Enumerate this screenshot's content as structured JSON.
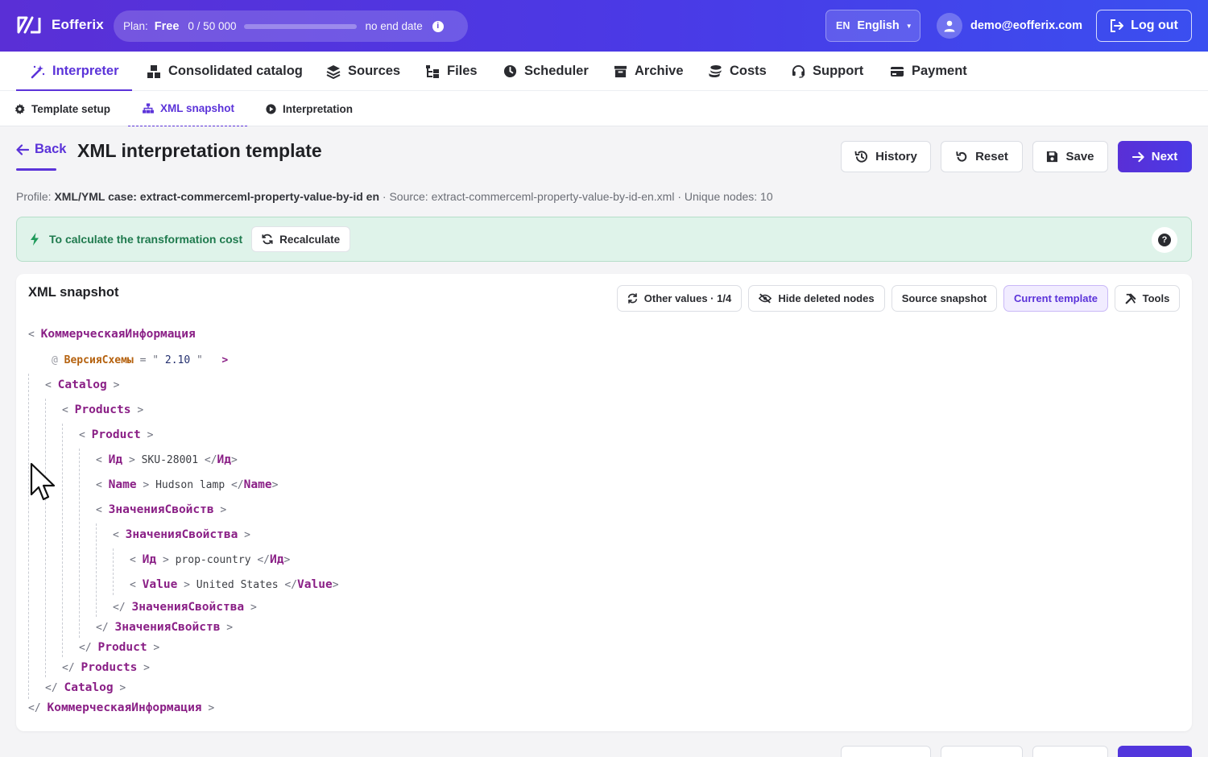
{
  "app": {
    "name": "Eofferix"
  },
  "plan": {
    "label": "Plan:",
    "name": "Free",
    "usage": "0 / 50 000",
    "usage_fraction": 0,
    "expiry": "no end date"
  },
  "language": {
    "code": "EN",
    "name": "English"
  },
  "user": {
    "email": "demo@eofferix.com"
  },
  "logout_label": "Log out",
  "main_nav": [
    "Interpreter",
    "Consolidated catalog",
    "Sources",
    "Files",
    "Scheduler",
    "Archive",
    "Costs",
    "Support",
    "Payment"
  ],
  "sub_nav": [
    "Template setup",
    "XML snapshot",
    "Interpretation"
  ],
  "page": {
    "back_label": "Back",
    "title": "XML interpretation template",
    "buttons": {
      "history": "History",
      "reset": "Reset",
      "save": "Save",
      "next": "Next"
    },
    "profile_label": "Profile:",
    "profile_value": "XML/YML case: extract-commerceml-property-value-by-id en",
    "source_text": "· Source: extract-commerceml-property-value-by-id-en.xml · Unique nodes: 10"
  },
  "cost_banner": {
    "text": "To calculate the transformation cost",
    "button": "Recalculate"
  },
  "snapshot": {
    "title": "XML snapshot",
    "toolbar": {
      "other_values": "Other values · 1/4",
      "hide_deleted": "Hide deleted nodes",
      "source_snapshot": "Source snapshot",
      "current_template": "Current template",
      "tools": "Tools"
    }
  },
  "xml_tree": {
    "root": "КоммерческаяИнформация",
    "root_attr_name": "ВерсияСхемы",
    "root_attr_value": "2.10",
    "catalog": "Catalog",
    "products": "Products",
    "product": "Product",
    "id_tag": "Ид",
    "id_value": "SKU-28001",
    "name_tag": "Name",
    "name_value": "Hudson lamp",
    "props_tag": "ЗначенияСвойств",
    "prop_tag": "ЗначенияСвойства",
    "prop_id_value": "prop-country",
    "value_tag": "Value",
    "value_value": "United States"
  }
}
